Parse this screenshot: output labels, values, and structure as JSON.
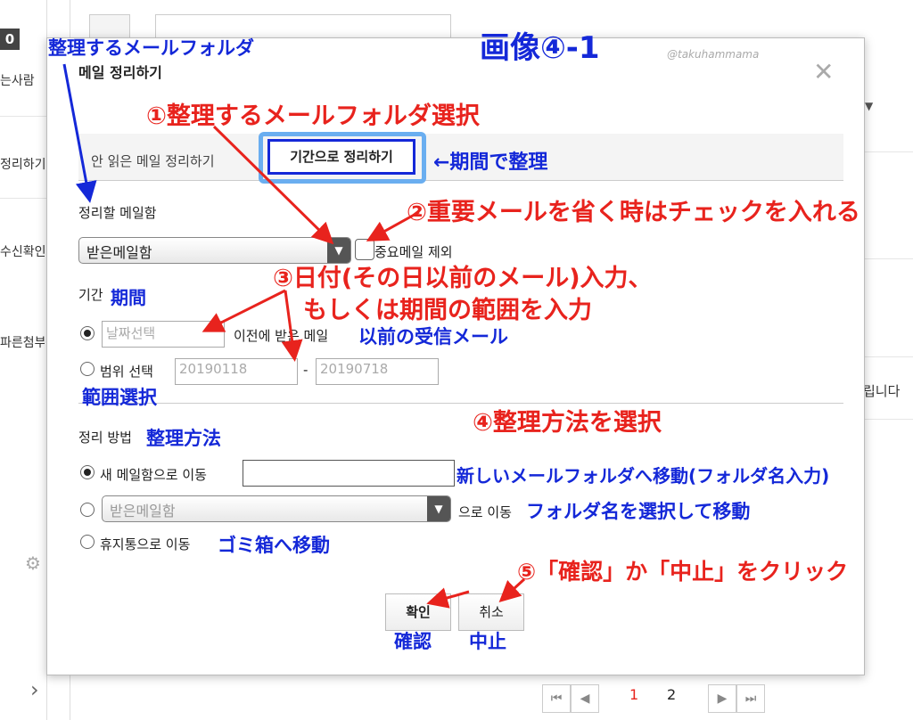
{
  "background": {
    "top_left_badge": "0",
    "sidebar": [
      "는사람",
      "정리하기",
      "수신확인",
      "파른첨부"
    ],
    "right_text": "립니다",
    "pagination": {
      "first": "⏮",
      "prev": "◀",
      "page1": "1",
      "page2": "2",
      "next": "▶",
      "last": "⏭"
    },
    "chevron": "›"
  },
  "modal": {
    "title": "메일 정리하기",
    "close": "✕",
    "tabs": {
      "unread": "안 읽은 메일 정리하기",
      "period": "기간으로 정리하기"
    },
    "mailbox_label": "정리할 메일함",
    "mailbox_select": "받은메일함",
    "exclude_important": "중요메일 제외",
    "period_label": "기간",
    "date_placeholder": "날짜선택",
    "before_text": "이전에 받은 메일",
    "range_label": "범위 선택",
    "range_from": "20190118",
    "range_dash": "-",
    "range_to": "20190718",
    "method_label": "정리 방법",
    "move_new_label": "새 메일함으로 이동",
    "move_select": "받은메일함",
    "move_select_suffix": "으로 이동",
    "trash_label": "휴지통으로 이동",
    "confirm": "확인",
    "cancel": "취소",
    "arrow_glyph": "▼"
  },
  "annotations": {
    "image_title": "画像④-1",
    "watermark": "@takuhammama",
    "folder_label": "整理するメールフォルダ",
    "step1": "①整理するメールフォルダ選択",
    "period_tab": "←期間で整理",
    "step2": "②重要メールを省く時はチェックを入れる",
    "step3_line1": "③日付(その日以前のメール)入力、",
    "step3_line2": "もしくは期間の範囲を入力",
    "kikan": "期間",
    "before_jp": "以前の受信メール",
    "range_jp": "範囲選択",
    "step4": "④整理方法を選択",
    "method_jp": "整理方法",
    "new_folder_jp": "新しいメールフォルダへ移動(フォルダ名入力)",
    "select_folder_jp": "フォルダ名を選択して移動",
    "trash_jp": "ゴミ箱へ移動",
    "step5": "⑤「確認」か「中止」をクリック",
    "confirm_jp": "確認",
    "cancel_jp": "中止"
  },
  "colors": {
    "annotation_red": "#e8231d",
    "annotation_blue": "#1428d8",
    "tab_highlight": "#6aaef0"
  }
}
